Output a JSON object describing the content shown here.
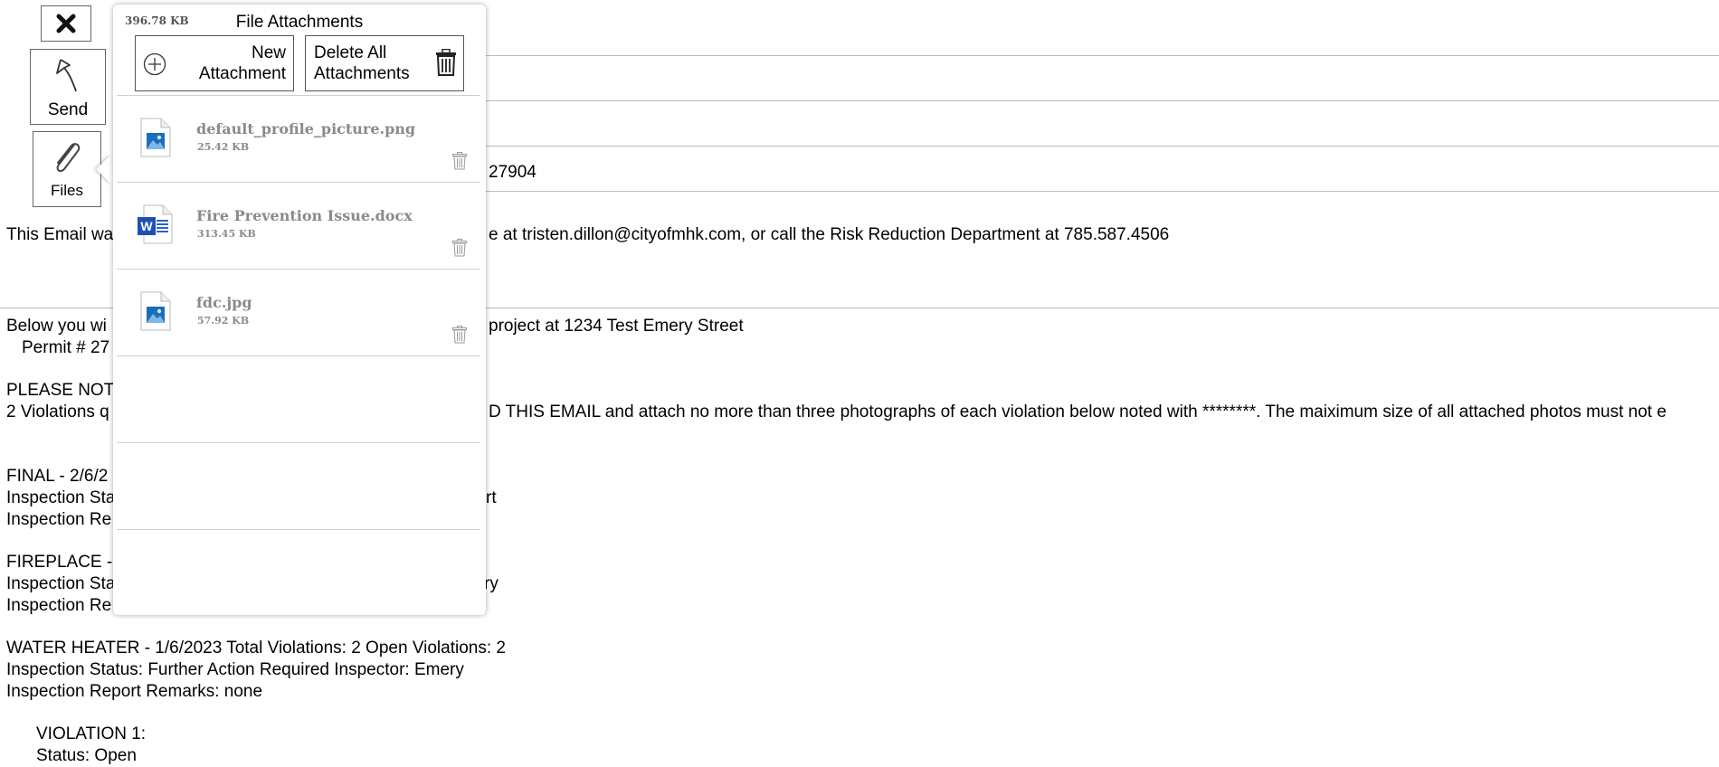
{
  "toolbar": {
    "close_icon": "close-icon",
    "send_label": "Send",
    "send_icon": "reply-arrow-icon",
    "files_label": "Files",
    "files_icon": "paperclip-icon"
  },
  "header": {
    "permit_suffix": "27904"
  },
  "email": {
    "notice_start": "This Email wa",
    "notice_end": "e at tristen.dillon@cityofmhk.com, or call the Risk Reduction Department at 785.587.4506",
    "below_start": "Below you wi",
    "below_end": "project at 1234 Test Emery Street",
    "permit_start": "Permit # 27",
    "please_note": "PLEASE NOT",
    "violations_start": "2 Violations q",
    "violations_end": "D THIS EMAIL and attach no more than three photographs of each violation below noted with ********. The maiximum size of all attached photos must not e",
    "final_start": "FINAL - 2/6/2",
    "final_status_start": "Inspection Sta",
    "final_status_end": "rt",
    "final_remarks_start": "Inspection Re",
    "fireplace_start": "FIREPLACE -",
    "fireplace_status_start": "Inspection Sta",
    "fireplace_status_end": "ry",
    "fireplace_remarks_start": "Inspection Re",
    "water_heater": "WATER HEATER - 1/6/2023  Total Violations: 2   Open Violations: 2",
    "water_status": "Inspection Status: Further Action Required   Inspector: Emery",
    "water_remarks": "Inspection Report Remarks: none",
    "violation1": "VIOLATION 1:",
    "status_open": "Status: Open"
  },
  "popup": {
    "total_size": "396.78 KB",
    "title": "File Attachments",
    "new_attachment_line1": "New",
    "new_attachment_line2": "Attachment",
    "delete_all_line1": "Delete All",
    "delete_all_line2": "Attachments",
    "files": [
      {
        "name": "default_profile_picture.png",
        "size": "25.42 KB",
        "icon": "image-file-icon"
      },
      {
        "name": "Fire Prevention Issue.docx",
        "size": "313.45 KB",
        "icon": "word-file-icon"
      },
      {
        "name": "fdc.jpg",
        "size": "57.92 KB",
        "icon": "image-file-icon"
      }
    ]
  }
}
